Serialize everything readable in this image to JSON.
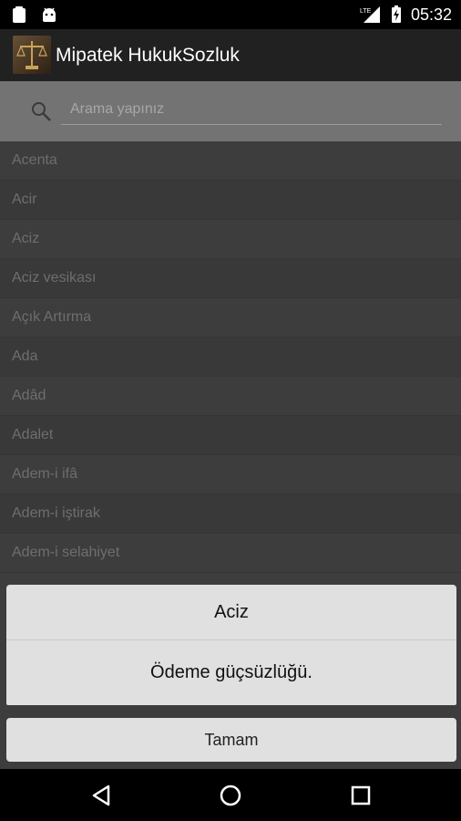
{
  "status_bar": {
    "time": "05:32",
    "network_label": "LTE",
    "icons": [
      "clipboard-icon",
      "android-icon",
      "signal-lte-icon",
      "battery-charging-icon"
    ]
  },
  "action_bar": {
    "title": "Mipatek HukukSozluk",
    "logo_icon": "scales-of-justice-logo"
  },
  "search": {
    "placeholder": "Arama yapınız",
    "icon": "search-icon"
  },
  "list": {
    "items": [
      "Acenta",
      "Acir",
      "Aciz",
      "Aciz vesikası",
      "Açık Artırma",
      "Ada",
      "Adâd",
      "Adalet",
      "Adem-i ifâ",
      "Adem-i iştirak",
      "Adem-i selahiyet"
    ]
  },
  "dialog": {
    "title": "Aciz",
    "message": "Ödeme güçsüzlüğü.",
    "ok_label": "Tamam"
  },
  "nav_bar": {
    "icons": [
      "back-icon",
      "home-icon",
      "recents-icon"
    ]
  }
}
